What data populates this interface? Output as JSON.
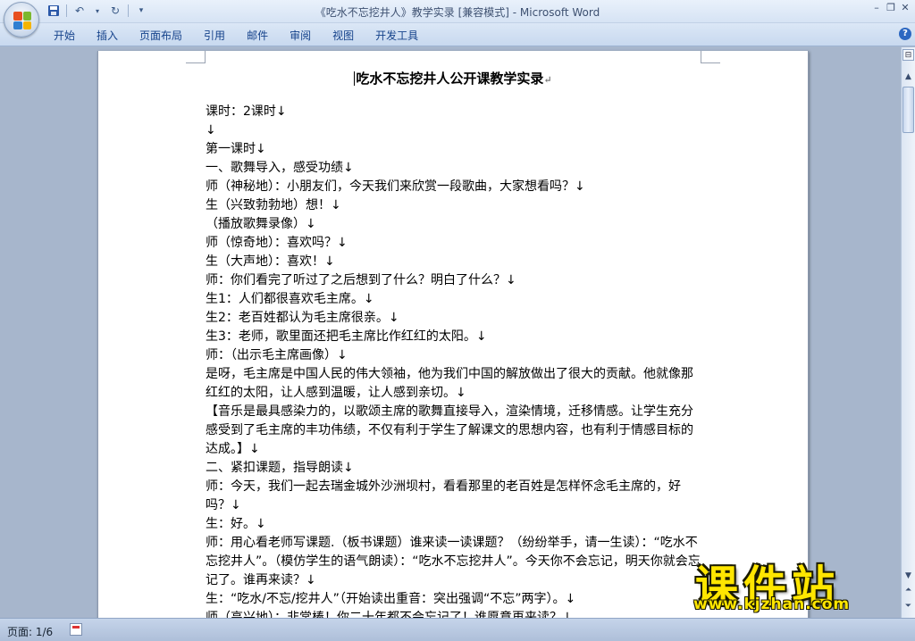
{
  "window": {
    "title": "《吃水不忘挖井人》教学实录 [兼容模式] - ",
    "app_name": "Microsoft Word"
  },
  "qat": {
    "save": "save-icon",
    "undo": "undo-icon",
    "redo": "redo-icon",
    "customize": "▾"
  },
  "ribbon": {
    "tabs": [
      "开始",
      "插入",
      "页面布局",
      "引用",
      "邮件",
      "审阅",
      "视图",
      "开发工具"
    ],
    "help": "?"
  },
  "document": {
    "title": "吃水不忘挖井人公开课教学实录",
    "paragraphs": [
      "课时：2课时↓",
      "↓",
      "第一课时↓",
      "一、歌舞导入，感受功绩↓",
      "师（神秘地）：小朋友们，今天我们来欣赏一段歌曲，大家想看吗？↓",
      "生（兴致勃勃地）想！↓",
      "（播放歌舞录像）↓",
      "师（惊奇地）：喜欢吗？↓",
      "生（大声地）：喜欢！↓",
      "师：你们看完了听过了之后想到了什么？明白了什么？↓",
      "生1：人们都很喜欢毛主席。↓",
      "生2：老百姓都认为毛主席很亲。↓",
      "生3：老师，歌里面还把毛主席比作红红的太阳。↓",
      "师：（出示毛主席画像）↓",
      "是呀，毛主席是中国人民的伟大领袖，他为我们中国的解放做出了很大的贡献。他就像那红红的太阳，让人感到温暖，让人感到亲切。↓",
      "【音乐是最具感染力的，以歌颂主席的歌舞直接导入，渲染情境，迁移情感。让学生充分感受到了毛主席的丰功伟绩，不仅有利于学生了解课文的思想内容，也有利于情感目标的达成。】↓",
      "二、紧扣课题，指导朗读↓",
      "师：今天，我们一起去瑞金城外沙洲坝村，看看那里的老百姓是怎样怀念毛主席的，好吗？↓",
      "生：好。↓",
      "师：用心看老师写课题.（板书课题）谁来读一读课题？（纷纷举手，请一生读）：“吃水不忘挖井人”。（模仿学生的语气朗读）：“吃水不忘挖井人”。今天你不会忘记，明天你就会忘记了。谁再来读？↓",
      "生：“吃水/不忘/挖井人”（开始读出重音：突出强调“不忘”两字）。↓",
      "师（高兴地）：非常棒！你二十年都不会忘记了！谁愿意再来读？↓"
    ]
  },
  "status": {
    "page": "页面: 1/6"
  },
  "watermark": {
    "big": "课件站",
    "small": "www.kjzhan.com"
  }
}
